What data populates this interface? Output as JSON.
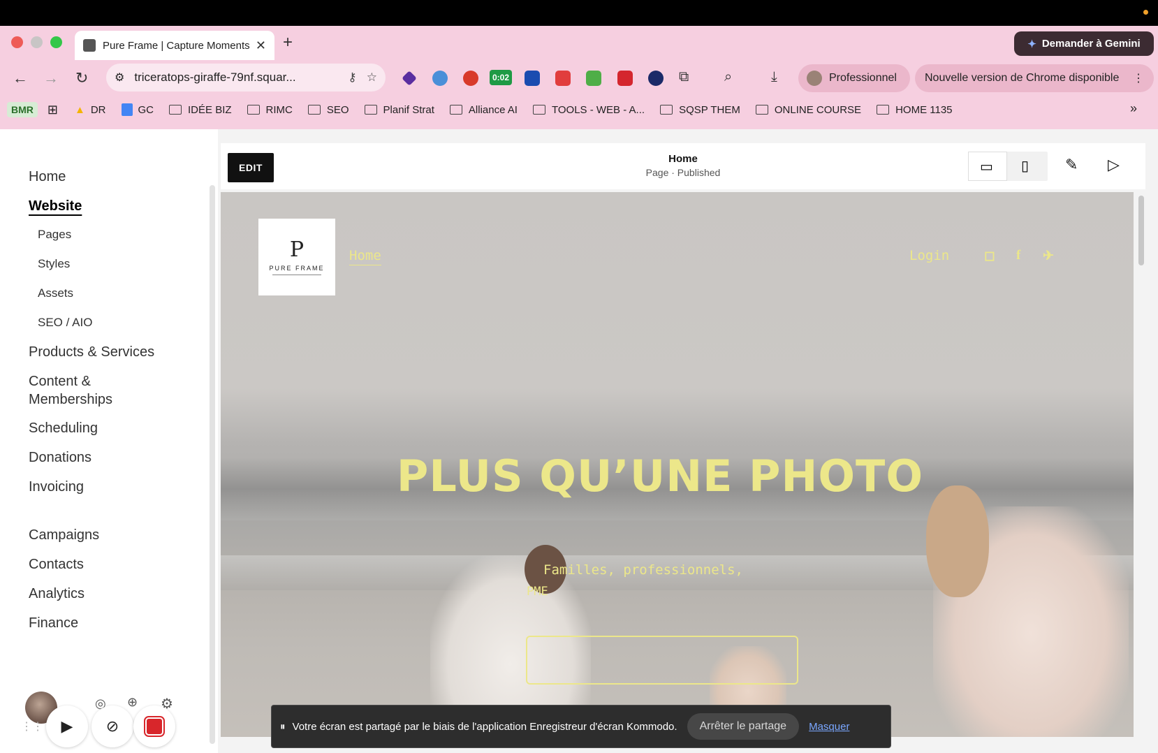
{
  "browser": {
    "tab_title": "Pure Frame | Capture Moments",
    "gemini_label": "Demander à Gemini",
    "url": "triceratops-giraffe-79nf.squar...",
    "ext_timer": "0:02",
    "profile_label": "Professionnel",
    "update_label": "Nouvelle version de Chrome disponible",
    "bookmarks": [
      {
        "label": "BMR"
      },
      {
        "label": "DR"
      },
      {
        "label": "GC"
      },
      {
        "label": "IDÉE BIZ"
      },
      {
        "label": "RIMC"
      },
      {
        "label": "SEO"
      },
      {
        "label": "Planif Strat"
      },
      {
        "label": "Alliance AI"
      },
      {
        "label": "TOOLS - WEB - A..."
      },
      {
        "label": "SQSP THEM"
      },
      {
        "label": "ONLINE COURSE"
      },
      {
        "label": "HOME 1135"
      }
    ]
  },
  "sidebar": {
    "items": [
      {
        "label": "Home"
      },
      {
        "label": "Website"
      },
      {
        "label": "Pages"
      },
      {
        "label": "Styles"
      },
      {
        "label": "Assets"
      },
      {
        "label": "SEO / AIO"
      },
      {
        "label": "Products & Services"
      },
      {
        "label": "Content &"
      },
      {
        "label": "Memberships"
      },
      {
        "label": "Scheduling"
      },
      {
        "label": "Donations"
      },
      {
        "label": "Invoicing"
      },
      {
        "label": "Campaigns"
      },
      {
        "label": "Contacts"
      },
      {
        "label": "Analytics"
      },
      {
        "label": "Finance"
      }
    ]
  },
  "editor": {
    "edit_label": "EDIT",
    "page_title": "Home",
    "page_status": "Page · Published"
  },
  "site": {
    "logo_letter": "P",
    "logo_name": "PURE FRAME",
    "nav_home": "Home",
    "login": "Login",
    "hero_title": "PLUS QU’UNE PHOTO",
    "hero_sub_1": "Familles, professionnels,",
    "hero_sub_2": "PME"
  },
  "share_bar": {
    "message": "Votre écran est partagé par le biais de l'application Enregistreur d'écran Kommodo.",
    "stop_label": "Arrêter le partage",
    "hide_label": "Masquer"
  },
  "colors": {
    "accent_yellow": "#ece78a",
    "chrome_pink": "#f6cfe0",
    "record_red": "#d8262b"
  }
}
